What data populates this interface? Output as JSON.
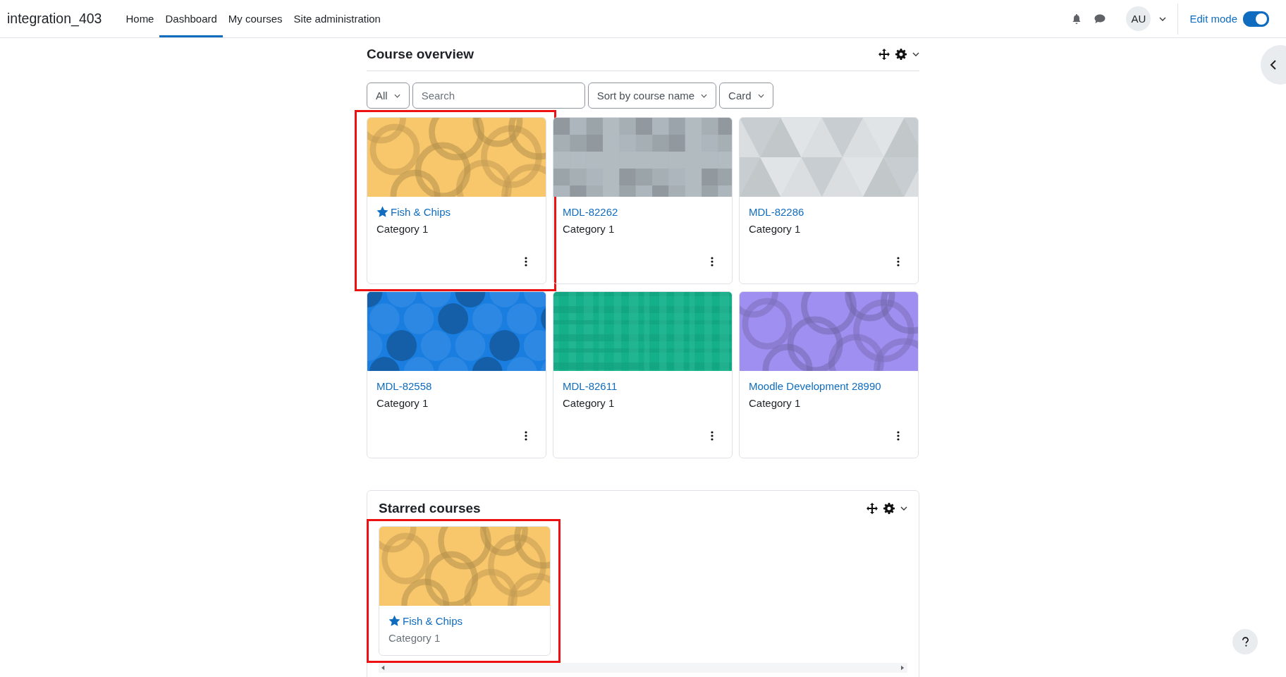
{
  "navbar": {
    "brand": "integration_403",
    "links": [
      {
        "label": "Home",
        "selected": false
      },
      {
        "label": "Dashboard",
        "selected": true
      },
      {
        "label": "My courses",
        "selected": false
      },
      {
        "label": "Site administration",
        "selected": false
      }
    ],
    "avatar": "AU",
    "edit_mode": {
      "label": "Edit mode",
      "on": true
    }
  },
  "course_overview": {
    "title": "Course overview",
    "filters": {
      "grouping": "All",
      "search_placeholder": "Search",
      "sort": "Sort by course name",
      "view": "Card"
    },
    "courses": [
      {
        "name": "Fish & Chips",
        "category": "Category 1",
        "starred": true,
        "highlighted": true,
        "image": {
          "kind": "circles",
          "color": "#f9c76b"
        }
      },
      {
        "name": "MDL-82262",
        "category": "Category 1",
        "starred": false,
        "highlighted": false,
        "image": {
          "kind": "squares",
          "color": "#aab4ba"
        }
      },
      {
        "name": "MDL-82286",
        "category": "Category 1",
        "starred": false,
        "highlighted": false,
        "image": {
          "kind": "triangles",
          "color": "#d3d8dc"
        }
      },
      {
        "name": "MDL-82558",
        "category": "Category 1",
        "starred": false,
        "highlighted": false,
        "image": {
          "kind": "octagons",
          "color": "#1a7ee0"
        }
      },
      {
        "name": "MDL-82611",
        "category": "Category 1",
        "starred": false,
        "highlighted": false,
        "image": {
          "kind": "plaid",
          "color": "#13b08a"
        }
      },
      {
        "name": "Moodle Development 28990",
        "category": "Category 1",
        "starred": false,
        "highlighted": false,
        "image": {
          "kind": "circles",
          "color": "#9f8ff0"
        }
      }
    ]
  },
  "starred_courses": {
    "title": "Starred courses",
    "courses": [
      {
        "name": "Fish & Chips",
        "category": "Category 1",
        "starred": true,
        "highlighted": true,
        "image": {
          "kind": "circles",
          "color": "#f9c76b"
        }
      }
    ]
  }
}
